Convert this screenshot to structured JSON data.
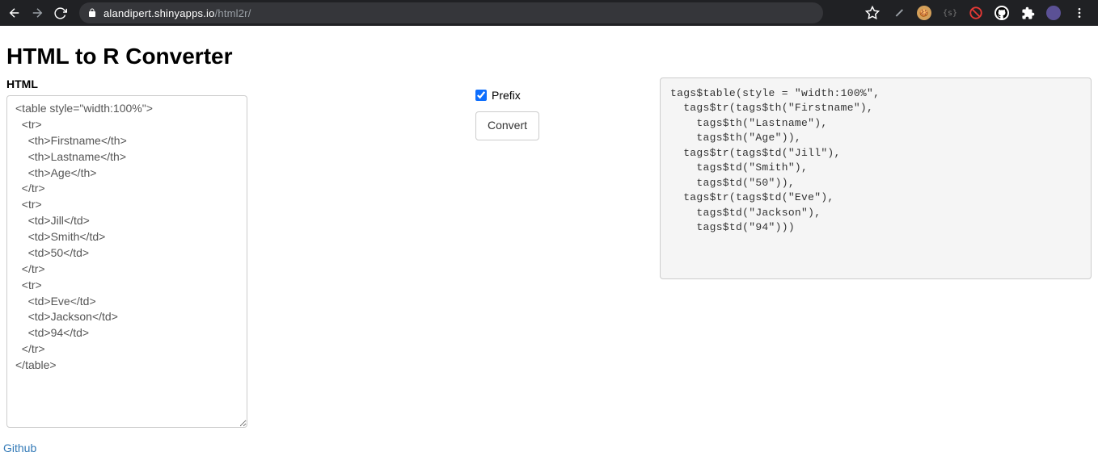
{
  "browser": {
    "url_host": "alandipert.shinyapps.io",
    "url_path": "/html2r/"
  },
  "page": {
    "title": "HTML to R Converter",
    "html_label": "HTML",
    "html_input_value": "<table style=\"width:100%\">\n  <tr>\n    <th>Firstname</th>\n    <th>Lastname</th>\n    <th>Age</th>\n  </tr>\n  <tr>\n    <td>Jill</td>\n    <td>Smith</td>\n    <td>50</td>\n  </tr>\n  <tr>\n    <td>Eve</td>\n    <td>Jackson</td>\n    <td>94</td>\n  </tr>\n</table>",
    "prefix_label": "Prefix",
    "prefix_checked": true,
    "convert_label": "Convert",
    "output_code": "tags$table(style = \"width:100%\",\n  tags$tr(tags$th(\"Firstname\"),\n    tags$th(\"Lastname\"),\n    tags$th(\"Age\")),\n  tags$tr(tags$td(\"Jill\"),\n    tags$td(\"Smith\"),\n    tags$td(\"50\")),\n  tags$tr(tags$td(\"Eve\"),\n    tags$td(\"Jackson\"),\n    tags$td(\"94\")))",
    "github_link": "Github"
  }
}
